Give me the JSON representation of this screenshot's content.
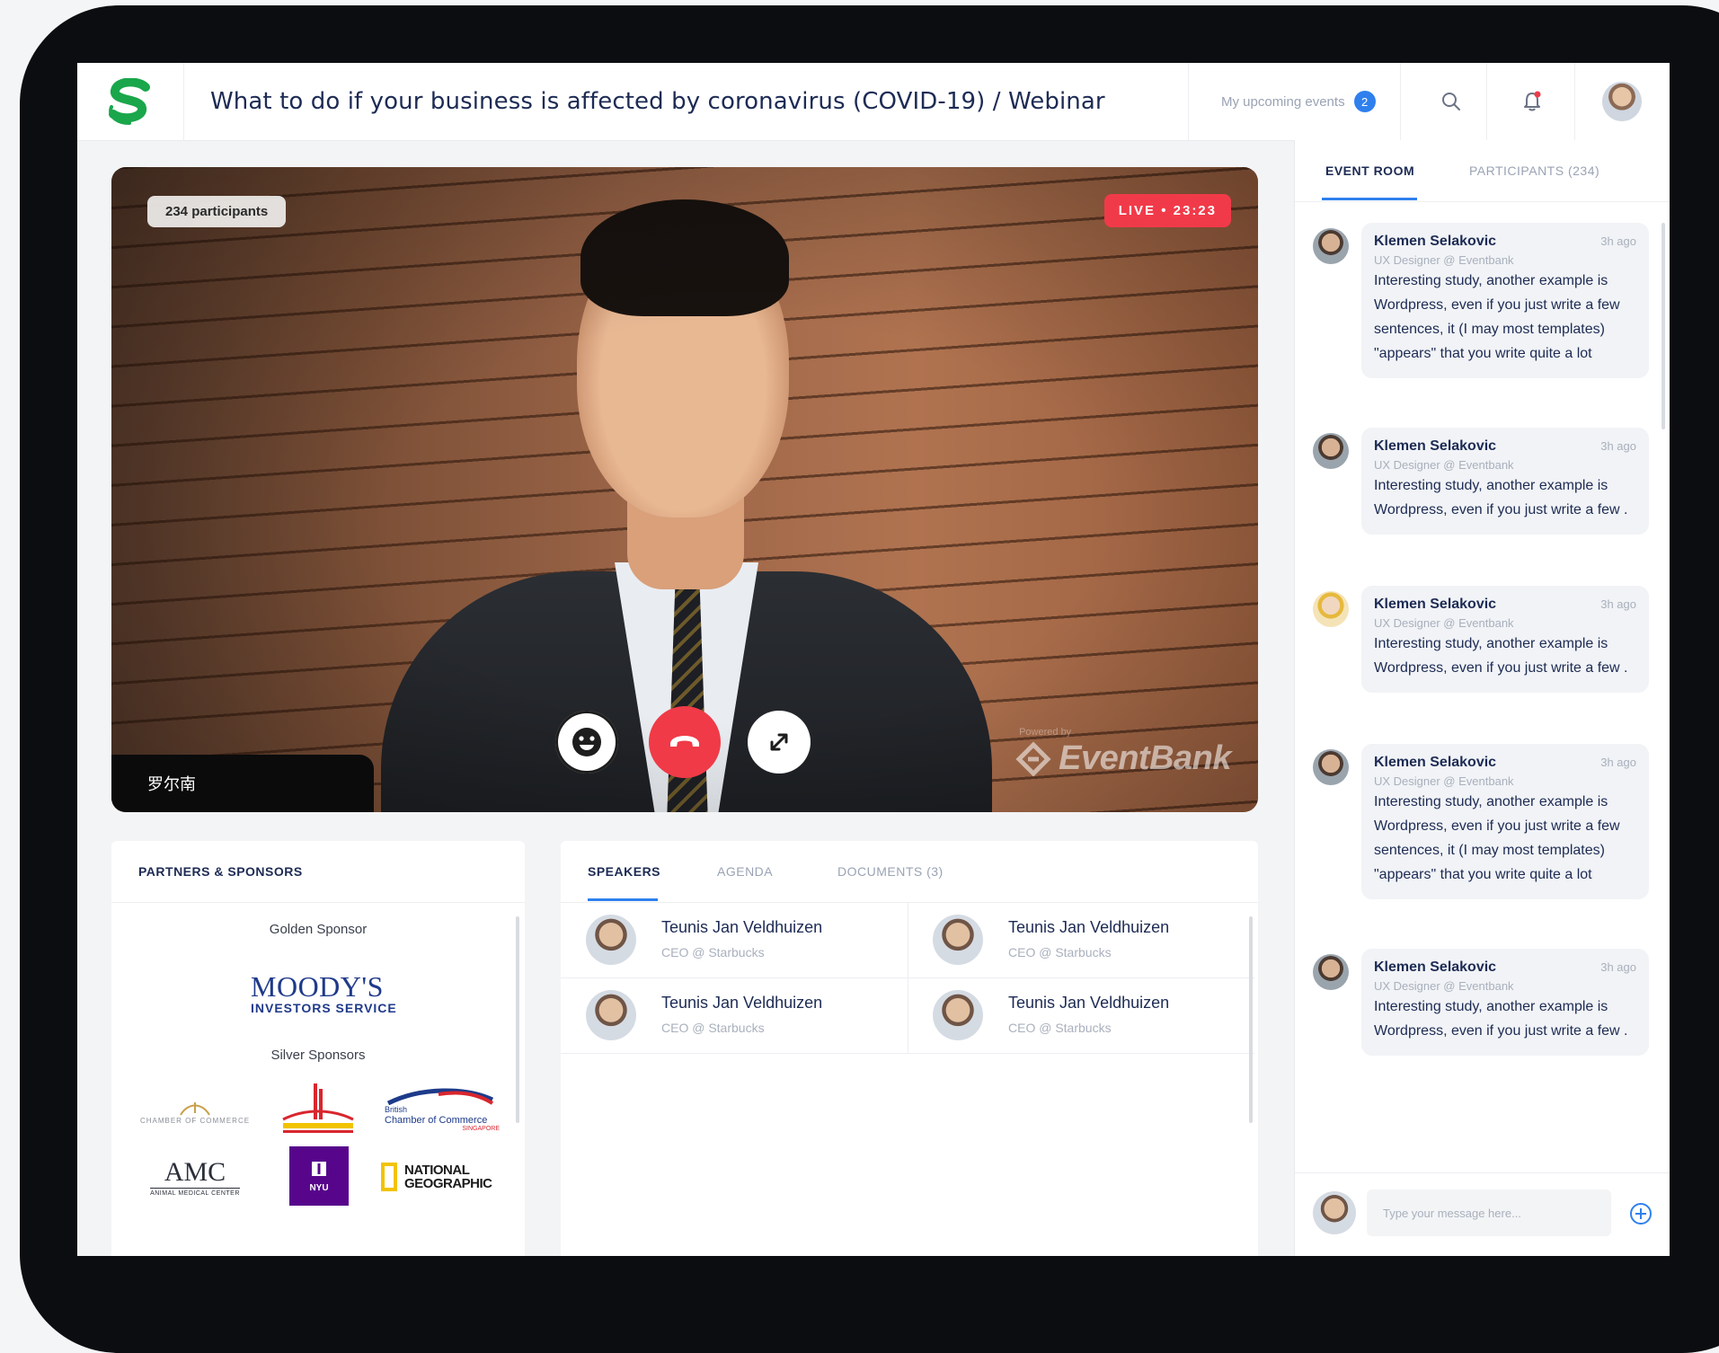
{
  "header": {
    "title": "What to do if your business is affected by coronavirus (COVID-19) / Webinar",
    "upcoming_label": "My upcoming events",
    "upcoming_count": "2"
  },
  "video": {
    "participants": "234 participants",
    "live": "LIVE • 23:23",
    "speaker_name": "罗尔南",
    "powered_by": "Powered by",
    "brand": "EventBank"
  },
  "sponsors": {
    "heading": "PARTNERS & SPONSORS",
    "golden_label": "Golden Sponsor",
    "moodys_big": "MOODY'S",
    "moodys_sub": "INVESTORS SERVICE",
    "silver_label": "Silver Sponsors",
    "logos": {
      "chamber": "CHAMBER OF COMMERCE",
      "british_1": "British",
      "british_2": "Chamber of Commerce",
      "british_3": "SINGAPORE",
      "amc": "AMC",
      "amc_sub": "ANIMAL MEDICAL CENTER",
      "nyu": "NYU",
      "natgeo_1": "NATIONAL",
      "natgeo_2": "GEOGRAPHIC"
    }
  },
  "speakers_panel": {
    "tabs": [
      "SPEAKERS",
      "AGENDA",
      "DOCUMENTS (3)"
    ],
    "speakers": [
      {
        "name": "Teunis Jan Veldhuizen",
        "role": "CEO @ Starbucks"
      },
      {
        "name": "Teunis Jan Veldhuizen",
        "role": "CEO @ Starbucks"
      },
      {
        "name": "Teunis Jan Veldhuizen",
        "role": "CEO @ Starbucks"
      },
      {
        "name": "Teunis Jan Veldhuizen",
        "role": "CEO @ Starbucks"
      }
    ]
  },
  "chat": {
    "tabs": [
      "EVENT ROOM",
      "PARTICIPANTS (234)"
    ],
    "messages": [
      {
        "author": "Klemen Selakovic",
        "ago": "3h ago",
        "role": "UX Designer @ Eventbank",
        "text": "Interesting study, another example is Wordpress, even if you just write a few sentences, it (I may most templates) \"appears\" that you write quite a lot"
      },
      {
        "author": "Klemen Selakovic",
        "ago": "3h ago",
        "role": "UX Designer @ Eventbank",
        "text": "Interesting study, another example is Wordpress, even if you just write a few ."
      },
      {
        "author": "Klemen Selakovic",
        "ago": "3h ago",
        "role": "UX Designer @ Eventbank",
        "text": "Interesting study, another example is Wordpress, even if you just write a few ."
      },
      {
        "author": "Klemen Selakovic",
        "ago": "3h ago",
        "role": "UX Designer @ Eventbank",
        "text": "Interesting study, another example is Wordpress, even if you just write a few sentences, it (I may most templates) \"appears\" that you write quite a lot"
      },
      {
        "author": "Klemen Selakovic",
        "ago": "3h ago",
        "role": "UX Designer @ Eventbank",
        "text": "Interesting study, another example is Wordpress, even if you just write a few ."
      }
    ],
    "input_placeholder": "Type your message here..."
  },
  "colors": {
    "accent": "#2f80ed",
    "live": "#f13a49",
    "hangup": "#f03a47",
    "brand_green": "#1aa64b",
    "navy": "#1d2b54"
  }
}
